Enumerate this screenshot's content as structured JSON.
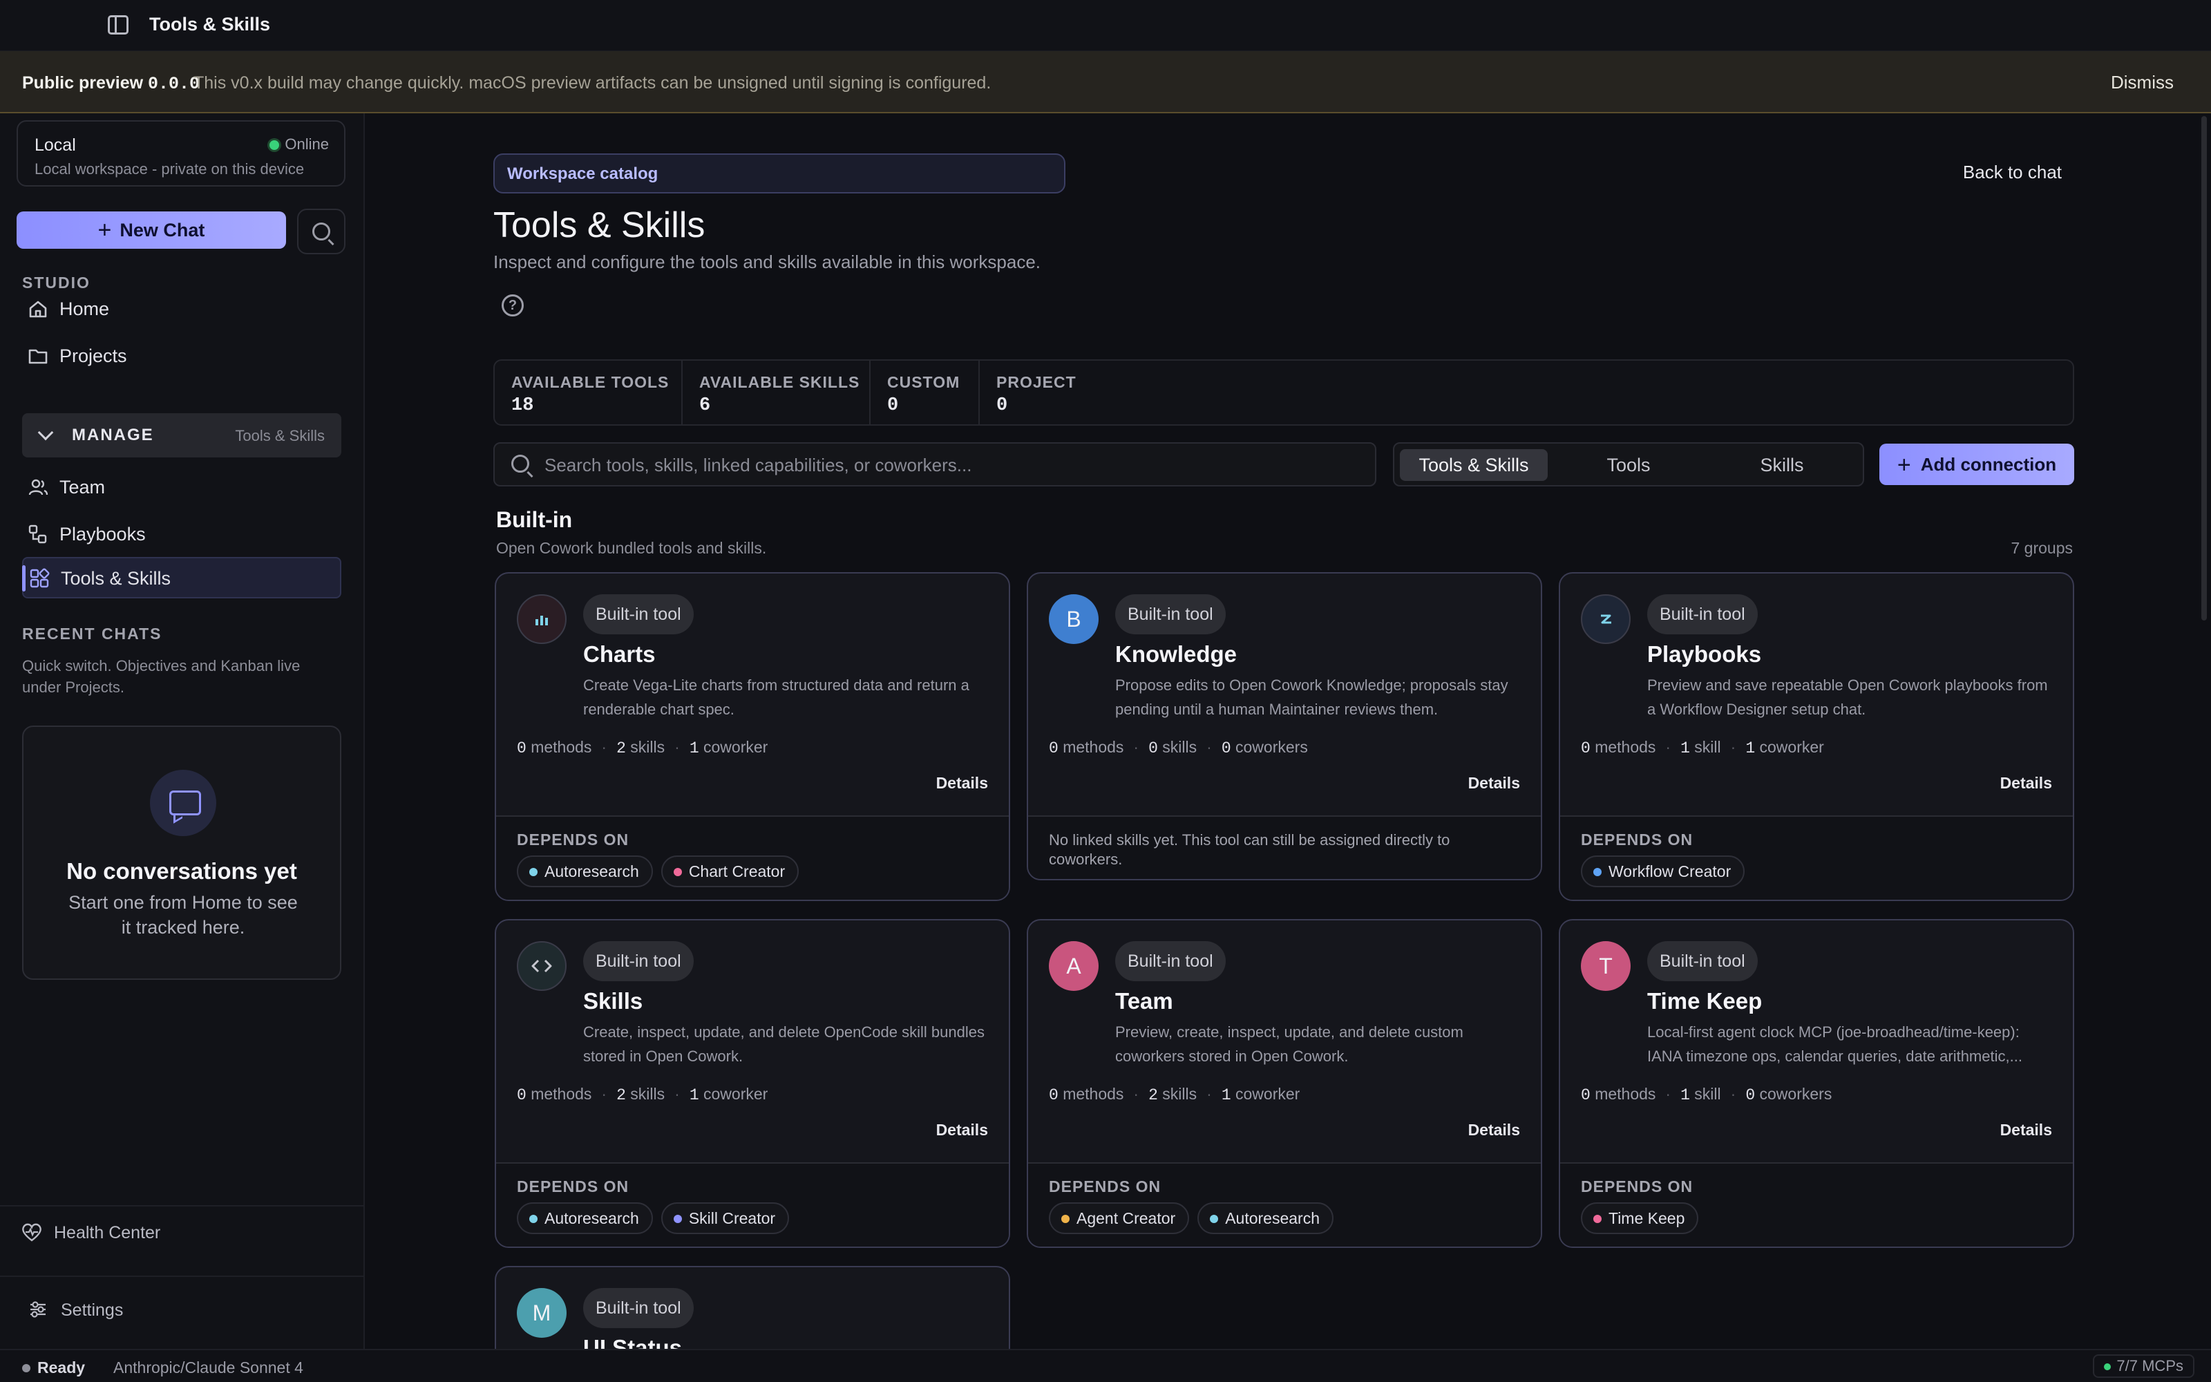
{
  "window": {
    "title": "Tools & Skills"
  },
  "banner": {
    "label": "Public preview",
    "version": "0.0.0",
    "message": "This v0.x build may change quickly. macOS preview artifacts can be unsigned until signing is configured.",
    "dismiss": "Dismiss"
  },
  "sidebar": {
    "workspace": {
      "name": "Local",
      "status": "Online",
      "description": "Local workspace - private on this device"
    },
    "new_chat": "New Chat",
    "studio_heading": "STUDIO",
    "studio_items": [
      {
        "label": "Home",
        "icon": "home-icon"
      },
      {
        "label": "Projects",
        "icon": "folder-icon"
      }
    ],
    "manage": {
      "label": "MANAGE",
      "current": "Tools & Skills"
    },
    "manage_items": [
      {
        "label": "Team",
        "icon": "users-icon"
      },
      {
        "label": "Playbooks",
        "icon": "playbook-icon"
      },
      {
        "label": "Tools & Skills",
        "icon": "grid-icon",
        "active": true
      }
    ],
    "recent_heading": "RECENT CHATS",
    "recent_description": "Quick switch. Objectives and Kanban live under Projects.",
    "empty": {
      "title": "No conversations yet",
      "text": "Start one from Home to see it tracked here."
    },
    "health_center": "Health Center",
    "settings": "Settings"
  },
  "main": {
    "catalog_label": "Workspace catalog",
    "back": "Back to chat",
    "title": "Tools & Skills",
    "description": "Inspect and configure the tools and skills available in this workspace.",
    "stats": [
      {
        "label": "AVAILABLE TOOLS",
        "value": "18"
      },
      {
        "label": "AVAILABLE SKILLS",
        "value": "6"
      },
      {
        "label": "CUSTOM",
        "value": "0"
      },
      {
        "label": "PROJECT",
        "value": "0"
      }
    ],
    "search_placeholder": "Search tools, skills, linked capabilities, or coworkers...",
    "filters": [
      "Tools & Skills",
      "Tools",
      "Skills"
    ],
    "selected_filter": "Tools & Skills",
    "add_connection": "Add connection",
    "section": {
      "title": "Built-in",
      "subtitle": "Open Cowork bundled tools and skills.",
      "count": "7 groups"
    },
    "depends_on_label": "DEPENDS ON",
    "details_label": "Details",
    "cards": [
      {
        "tag": "Built-in tool",
        "name": "Charts",
        "avatar": "chart-icon",
        "avatar_bg": "#2a1d24",
        "description": "Create Vega-Lite charts from structured data and return a renderable chart spec.",
        "methods": "0",
        "methods_label": "methods",
        "skills": "2",
        "skills_label": "skills",
        "coworkers": "1",
        "coworkers_label": "coworker",
        "depends": [
          {
            "name": "Autoresearch",
            "color": "#7fd3ea"
          },
          {
            "name": "Chart Creator",
            "color": "#f06a9a"
          }
        ]
      },
      {
        "tag": "Built-in tool",
        "name": "Knowledge",
        "avatar": "B",
        "avatar_bg": "#3f7fd0",
        "description": "Propose edits to Open Cowork Knowledge; proposals stay pending until a human Maintainer reviews them.",
        "methods": "0",
        "methods_label": "methods",
        "skills": "0",
        "skills_label": "skills",
        "coworkers": "0",
        "coworkers_label": "coworkers",
        "note": "No linked skills yet. This tool can still be assigned directly to coworkers."
      },
      {
        "tag": "Built-in tool",
        "name": "Playbooks",
        "avatar": "playbook-icon",
        "avatar_bg": "#1e2636",
        "description": "Preview and save repeatable Open Cowork playbooks from a Workflow Designer setup chat.",
        "methods": "0",
        "methods_label": "methods",
        "skills": "1",
        "skills_label": "skill",
        "coworkers": "1",
        "coworkers_label": "coworker",
        "depends": [
          {
            "name": "Workflow Creator",
            "color": "#5fa3f5"
          }
        ]
      },
      {
        "tag": "Built-in tool",
        "name": "Skills",
        "avatar": "code-icon",
        "avatar_bg": "#1f2a2e",
        "description": "Create, inspect, update, and delete OpenCode skill bundles stored in Open Cowork.",
        "methods": "0",
        "methods_label": "methods",
        "skills": "2",
        "skills_label": "skills",
        "coworkers": "1",
        "coworkers_label": "coworker",
        "depends": [
          {
            "name": "Autoresearch",
            "color": "#7fd3ea"
          },
          {
            "name": "Skill Creator",
            "color": "#8f93ff"
          }
        ]
      },
      {
        "tag": "Built-in tool",
        "name": "Team",
        "avatar": "A",
        "avatar_bg": "#c9557e",
        "description": "Preview, create, inspect, update, and delete custom coworkers stored in Open Cowork.",
        "methods": "0",
        "methods_label": "methods",
        "skills": "2",
        "skills_label": "skills",
        "coworkers": "1",
        "coworkers_label": "coworker",
        "depends": [
          {
            "name": "Agent Creator",
            "color": "#f0b34a"
          },
          {
            "name": "Autoresearch",
            "color": "#7fd3ea"
          }
        ]
      },
      {
        "tag": "Built-in tool",
        "name": "Time Keep",
        "avatar": "T",
        "avatar_bg": "#c9557e",
        "description": "Local-first agent clock MCP (joe-broadhead/time-keep): IANA timezone ops, calendar queries, date arithmetic,...",
        "methods": "0",
        "methods_label": "methods",
        "skills": "1",
        "skills_label": "skill",
        "coworkers": "0",
        "coworkers_label": "coworkers",
        "depends": [
          {
            "name": "Time Keep",
            "color": "#f06a9a"
          }
        ]
      },
      {
        "tag": "Built-in tool",
        "name": "UI Status",
        "avatar": "M",
        "avatar_bg": "#4c9fae"
      }
    ]
  },
  "statusbar": {
    "status": "Ready",
    "model": "Anthropic/Claude Sonnet 4",
    "mcps": "7/7 MCPs"
  }
}
